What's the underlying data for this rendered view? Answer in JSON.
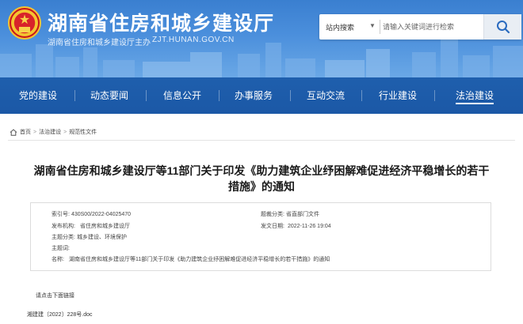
{
  "header": {
    "title": "湖南省住房和城乡建设厅",
    "subtitle": "湖南省住房和城乡建设厅主办",
    "url": "ZJT.HUNAN.GOV.CN",
    "search": {
      "scope_label": "站内搜索",
      "placeholder": "请输入关键词进行检索",
      "button_icon": "search-icon"
    }
  },
  "nav": {
    "items": [
      {
        "label": "党的建设"
      },
      {
        "label": "动态要闻"
      },
      {
        "label": "信息公开"
      },
      {
        "label": "办事服务"
      },
      {
        "label": "互动交流"
      },
      {
        "label": "行业建设"
      },
      {
        "label": "法治建设",
        "active": true
      }
    ]
  },
  "breadcrumb": {
    "items": [
      "首页",
      "法治建设",
      "规范性文件"
    ]
  },
  "article": {
    "title_line1": "湖南省住房和城乡建设厅等11部门关于印发《助力建筑企业纾困解难促进经济平稳增长的若干",
    "title_line2": "措施》的通知",
    "meta": {
      "index_label": "索引号:",
      "index_value": "430S00/2022-04025470",
      "category_label": "题裁分类:",
      "category_value": "省直部门文件",
      "issuer_label": "发布机构:",
      "issuer_value": "省住房和城乡建设厅",
      "date_label": "发文日期:",
      "date_value": "2022-11-26 19:04",
      "topic_label": "主题分类:",
      "topic_value": "城乡建设、环境保护",
      "keywords_label": "主题词:",
      "keywords_value": "",
      "name_label": "名称:",
      "name_value": "湖南省住房和城乡建设厅等11部门关于印发《助力建筑企业纾困解难促进经济平稳增长的若干措施》的通知"
    },
    "link_hint": "请点击下面链接",
    "attachment": "湘建建〔2022〕228号.doc"
  },
  "colors": {
    "header_blue": "#3a7fd0",
    "nav_blue": "#1b58a6",
    "emblem_red": "#d8232a",
    "emblem_gold": "#f4c430"
  }
}
